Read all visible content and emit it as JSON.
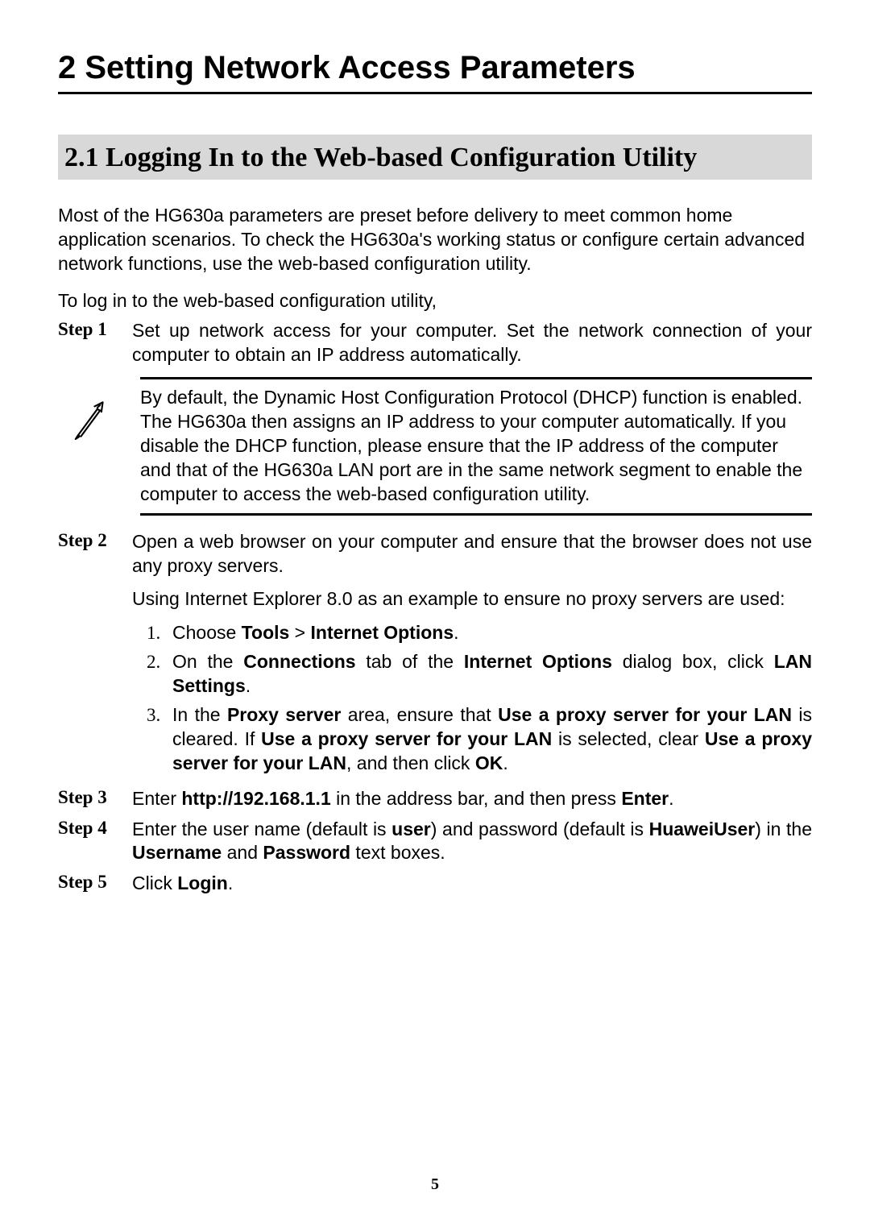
{
  "chapter": {
    "number": "2",
    "title": "Setting Network Access Parameters"
  },
  "section": {
    "number": "2.1",
    "title": "Logging In to the Web-based Configuration Utility"
  },
  "intro_paragraph": "Most of the HG630a parameters are preset before delivery to meet common home application scenarios. To check the HG630a's working status or configure certain advanced network functions, use the web-based configuration utility.",
  "lead_in": "To log in to the web-based configuration utility,",
  "steps": {
    "step1": {
      "label": "Step 1",
      "text": "Set up network access for your computer. Set the network connection of your computer to obtain an IP address automatically."
    },
    "note": "By default, the Dynamic Host Configuration Protocol (DHCP) function is enabled. The HG630a then assigns an IP address to your computer automatically. If you disable the DHCP function, please ensure that the IP address of the computer and that of the HG630a LAN port are in the same network segment to enable the computer to access the web-based configuration utility.",
    "step2": {
      "label": "Step 2",
      "p1": "Open a web browser on your computer and ensure that the browser does not use any proxy servers.",
      "p2": "Using Internet Explorer 8.0 as an example to ensure no proxy servers are used:",
      "items": {
        "i1": {
          "pre1": "Choose ",
          "b1": "Tools",
          "mid1": " > ",
          "b2": "Internet Options",
          "post1": "."
        },
        "i2": {
          "pre1": "On the ",
          "b1": "Connections",
          "mid1": " tab of the ",
          "b2": "Internet Options",
          "mid2": " dialog box, click ",
          "b3": "LAN Settings",
          "post1": "."
        },
        "i3": {
          "pre1": "In the ",
          "b1": "Proxy server",
          "mid1": " area, ensure that ",
          "b2": "Use a proxy server for your LAN",
          "mid2": " is cleared. If ",
          "b3": "Use a proxy server for your LAN",
          "mid3": " is selected, clear ",
          "b4": "Use a proxy server for your LAN",
          "mid4": ", and then click ",
          "b5": "OK",
          "post1": "."
        }
      }
    },
    "step3": {
      "label": "Step 3",
      "pre1": "Enter ",
      "b1": "http://192.168.1.1",
      "mid1": " in the address bar, and then press ",
      "b2": "Enter",
      "post1": "."
    },
    "step4": {
      "label": "Step 4",
      "pre1": "Enter the user name (default is ",
      "b1": "user",
      "mid1": ") and password (default is ",
      "b2": "HuaweiUser",
      "mid2": ") in the ",
      "b3": "Username",
      "mid3": " and ",
      "b4": "Password",
      "post1": " text boxes."
    },
    "step5": {
      "label": "Step 5",
      "pre1": "Click ",
      "b1": "Login",
      "post1": "."
    }
  },
  "page_number": "5",
  "icons": {
    "note": "pencil-note-icon"
  }
}
